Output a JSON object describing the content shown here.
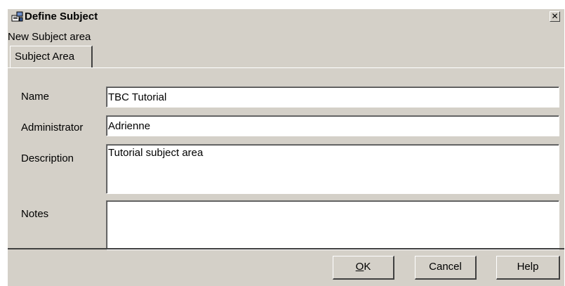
{
  "window": {
    "title": "Define Subject",
    "close_glyph": "✕",
    "icon": "define-subject-icon"
  },
  "header": {
    "subtitle": "New Subject area"
  },
  "tabs": [
    {
      "label": "Subject Area",
      "selected": true
    }
  ],
  "form": {
    "name_label": "Name",
    "name_value": "TBC Tutorial",
    "administrator_label": "Administrator",
    "administrator_value": "Adrienne",
    "description_label": "Description",
    "description_value": "Tutorial subject area",
    "notes_label": "Notes",
    "notes_value": ""
  },
  "buttons": {
    "ok_mnemonic": "O",
    "ok_rest": "K",
    "cancel": "Cancel",
    "help": "Help"
  },
  "colors": {
    "face": "#d4d0c8",
    "field": "#ffffff",
    "shadow": "#404040"
  }
}
